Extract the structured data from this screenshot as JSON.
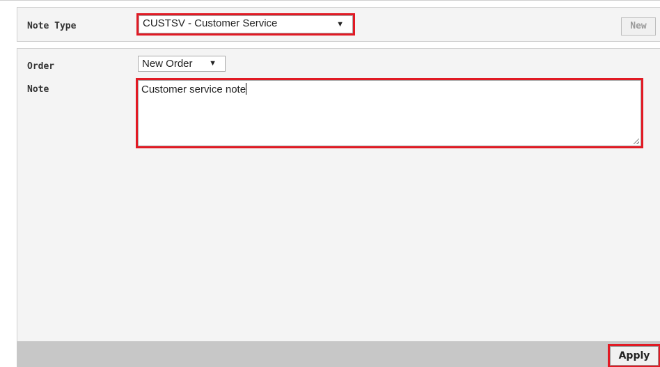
{
  "header": {
    "note_type_label": "Note Type",
    "note_type_value": "CUSTSV - Customer Service",
    "new_button_label": "New"
  },
  "form": {
    "order_label": "Order",
    "order_value": "New Order",
    "note_label": "Note",
    "note_value": "Customer service note"
  },
  "footer": {
    "apply_button_label": "Apply"
  },
  "colors": {
    "highlight": "#e11a24",
    "panel_bg": "#f4f4f4",
    "footer_bg": "#c7c7c7"
  },
  "icons": {
    "dropdown_arrow": "triangle-down-icon",
    "resize_grip": "resize-grip-icon"
  }
}
